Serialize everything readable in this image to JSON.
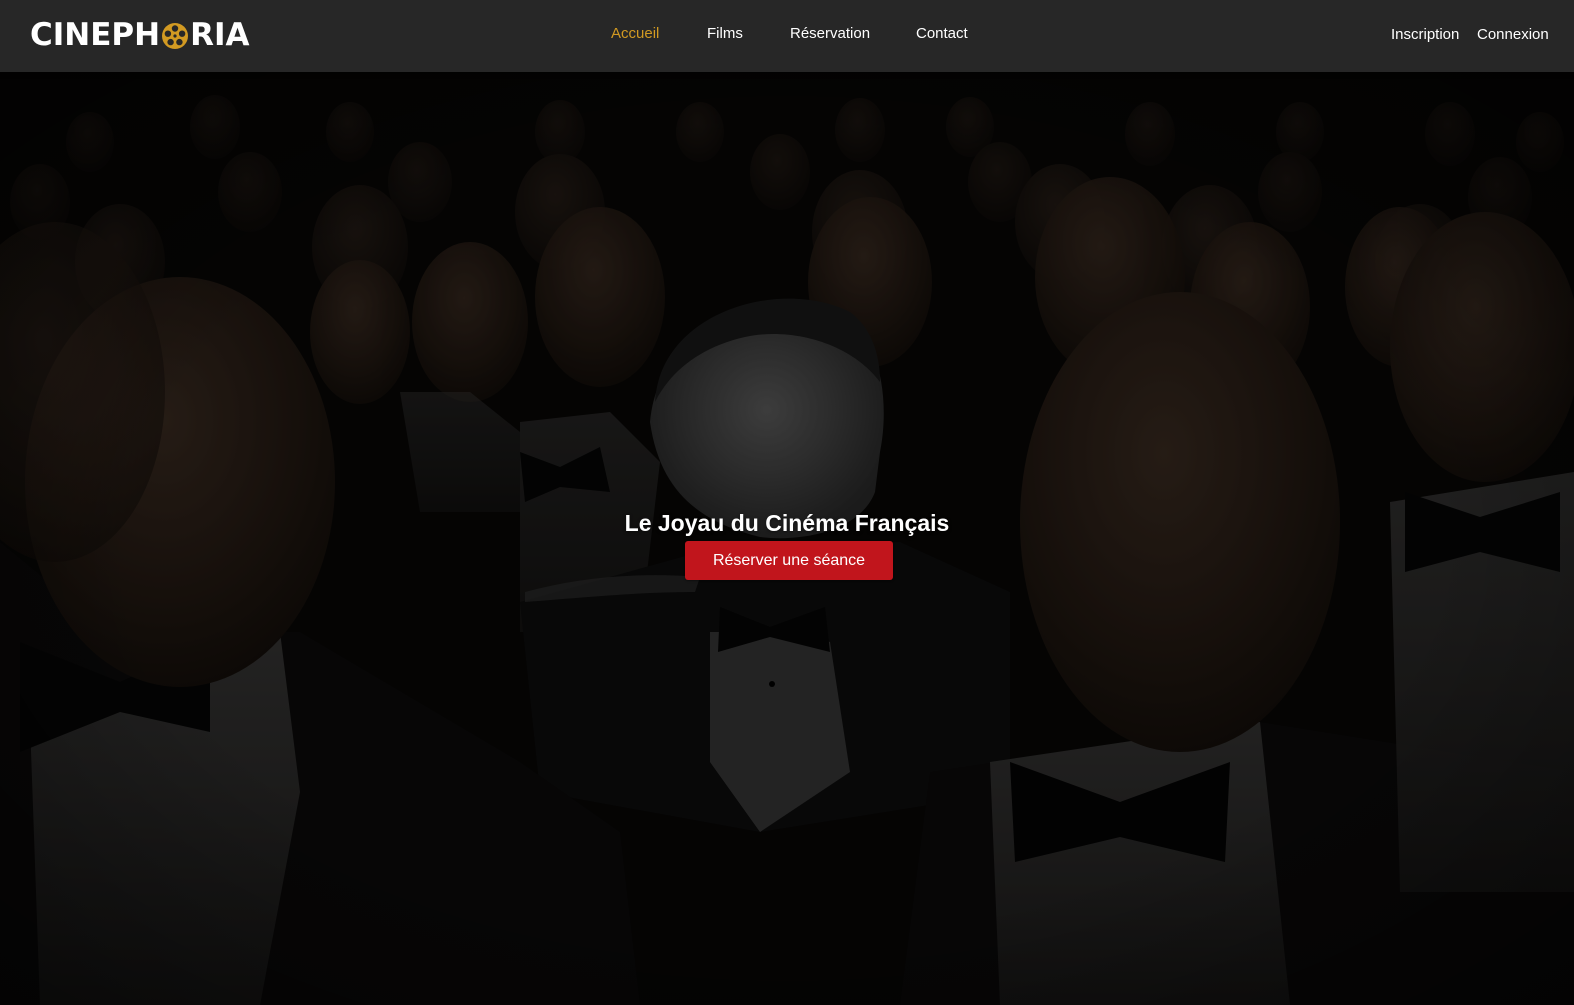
{
  "brand": {
    "logo_before": "CINEPH",
    "logo_after": "RIA",
    "logo_icon": "film-reel-icon",
    "accent_color": "#d29a22"
  },
  "nav": {
    "items": [
      {
        "label": "Accueil",
        "active": true
      },
      {
        "label": "Films",
        "active": false
      },
      {
        "label": "Réservation",
        "active": false
      },
      {
        "label": "Contact",
        "active": false
      }
    ],
    "auth": {
      "signup_label": "Inscription",
      "login_label": "Connexion"
    }
  },
  "hero": {
    "title": "Le Joyau du Cinéma Français",
    "cta_label": "Réserver une séance",
    "cta_color": "#c1151c"
  }
}
